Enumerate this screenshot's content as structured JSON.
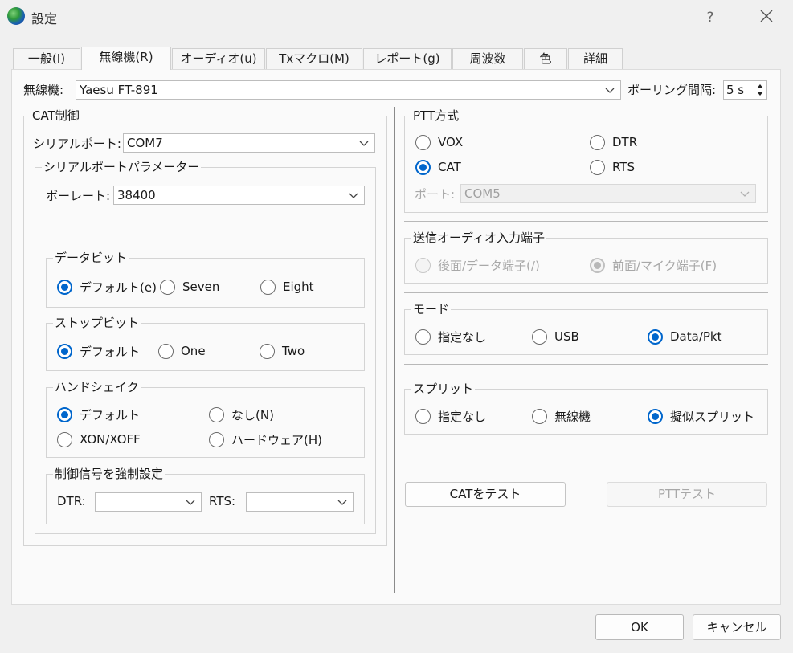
{
  "window": {
    "title": "設定",
    "help_glyph": "?"
  },
  "tabs": [
    {
      "label": "一般(I)",
      "active": false
    },
    {
      "label": "無線機(R)",
      "active": true
    },
    {
      "label": "オーディオ(u)",
      "active": false
    },
    {
      "label": "Txマクロ(M)",
      "active": false
    },
    {
      "label": "レポート(g)",
      "active": false
    },
    {
      "label": "周波数",
      "active": false
    },
    {
      "label": "色",
      "active": false
    },
    {
      "label": "詳細",
      "active": false
    }
  ],
  "rig": {
    "label": "無線機:",
    "value": "Yaesu FT-891",
    "polling_label": "ポーリング間隔:",
    "polling_value": "5 s"
  },
  "cat": {
    "group_label": "CAT制御",
    "serial_port_label": "シリアルポート:",
    "serial_port_value": "COM7",
    "params_label": "シリアルポートパラメーター",
    "baud_label": "ボーレート:",
    "baud_value": "38400",
    "data_bits": {
      "label": "データビット",
      "options": [
        "デフォルト(e)",
        "Seven",
        "Eight"
      ],
      "selected": "デフォルト(e)"
    },
    "stop_bits": {
      "label": "ストップビット",
      "options": [
        "デフォルト",
        "One",
        "Two"
      ],
      "selected": "デフォルト"
    },
    "handshake": {
      "label": "ハンドシェイク",
      "options": [
        "デフォルト",
        "なし(N)",
        "XON/XOFF",
        "ハードウェア(H)"
      ],
      "selected": "デフォルト"
    },
    "force_signals": {
      "label": "制御信号を強制設定",
      "dtr_label": "DTR:",
      "dtr_value": "",
      "rts_label": "RTS:",
      "rts_value": ""
    }
  },
  "ptt": {
    "label": "PTT方式",
    "options": [
      "VOX",
      "DTR",
      "CAT",
      "RTS"
    ],
    "selected": "CAT",
    "port_label": "ポート:",
    "port_value": "COM5"
  },
  "tx_audio": {
    "label": "送信オーディオ入力端子",
    "options": [
      "後面/データ端子(/)",
      "前面/マイク端子(F)"
    ],
    "selected": "前面/マイク端子(F)"
  },
  "mode": {
    "label": "モード",
    "options": [
      "指定なし",
      "USB",
      "Data/Pkt"
    ],
    "selected": "Data/Pkt"
  },
  "split": {
    "label": "スプリット",
    "options": [
      "指定なし",
      "無線機",
      "擬似スプリット"
    ],
    "selected": "擬似スプリット"
  },
  "buttons": {
    "test_cat": "CATをテスト",
    "test_ptt": "PTTテスト",
    "ok": "OK",
    "cancel": "キャンセル"
  },
  "icons": {
    "app": "globe-icon",
    "close": "close-icon",
    "dropdown": "chevron-down-icon",
    "spin": "spin-arrows-icon"
  }
}
